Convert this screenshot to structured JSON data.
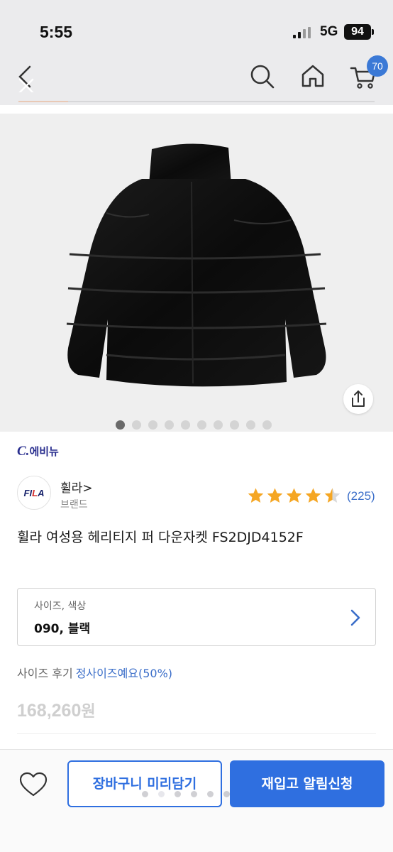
{
  "status_bar": {
    "time": "5:55",
    "network": "5G",
    "battery": "94"
  },
  "nav": {
    "cart_count": "70",
    "image_progress": 0.14
  },
  "gallery": {
    "dot_count": 10,
    "active_index": 0
  },
  "seller": {
    "logo_mark": "C.",
    "logo_text": "에비뉴"
  },
  "brand": {
    "logo_text_main": "FI",
    "logo_text_accent": "L",
    "logo_text_end": "A",
    "name": "휠라>",
    "subtitle": "브랜드"
  },
  "rating": {
    "stars": 4.5,
    "count": "(225)",
    "star_color": "#f5a623"
  },
  "product": {
    "title": "휠라 여성용 헤리티지 퍼 다운자켓 FS2DJD4152F"
  },
  "option": {
    "label": "사이즈, 색상",
    "value": "090, 블랙"
  },
  "size_review": {
    "label": "사이즈 후기",
    "value": "정사이즈예요(50%)"
  },
  "price": {
    "amount": "168,260",
    "unit": "원"
  },
  "actions": {
    "cart_add_label": "장바구니 미리담기",
    "restock_label": "재입고 알림신청",
    "accent_color": "#2f6fe0"
  }
}
